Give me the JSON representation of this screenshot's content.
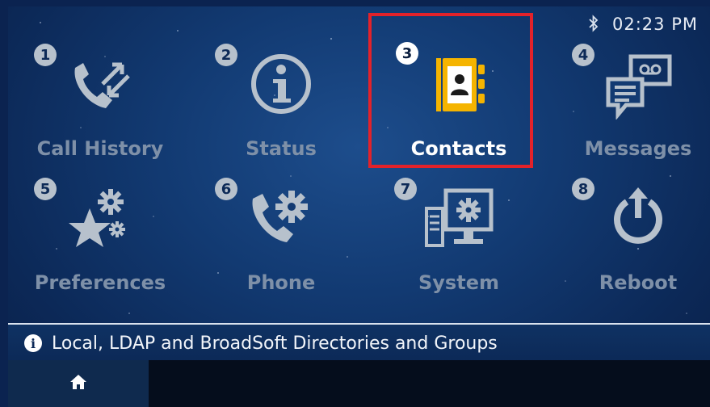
{
  "status": {
    "time": "02:23 PM",
    "bluetooth_icon": "bluetooth-icon"
  },
  "tiles": [
    {
      "number": "1",
      "label": "Call History",
      "icon": "call-history-icon"
    },
    {
      "number": "2",
      "label": "Status",
      "icon": "info-icon"
    },
    {
      "number": "3",
      "label": "Contacts",
      "icon": "contacts-book-icon",
      "selected": true
    },
    {
      "number": "4",
      "label": "Messages",
      "icon": "voicemail-messages-icon"
    },
    {
      "number": "5",
      "label": "Preferences",
      "icon": "star-gear-icon"
    },
    {
      "number": "6",
      "label": "Phone",
      "icon": "phone-gear-icon"
    },
    {
      "number": "7",
      "label": "System",
      "icon": "computer-gear-icon"
    },
    {
      "number": "8",
      "label": "Reboot",
      "icon": "power-reboot-icon"
    }
  ],
  "info_bar": {
    "text": "Local, LDAP and BroadSoft Directories and Groups",
    "icon": "info-circle-icon"
  },
  "bottom_bar": {
    "home_icon": "home-icon"
  },
  "colors": {
    "highlight": "#e3222a",
    "accent_yellow": "#f5b400",
    "inactive": "#7e90a8",
    "background": "#123a72"
  }
}
